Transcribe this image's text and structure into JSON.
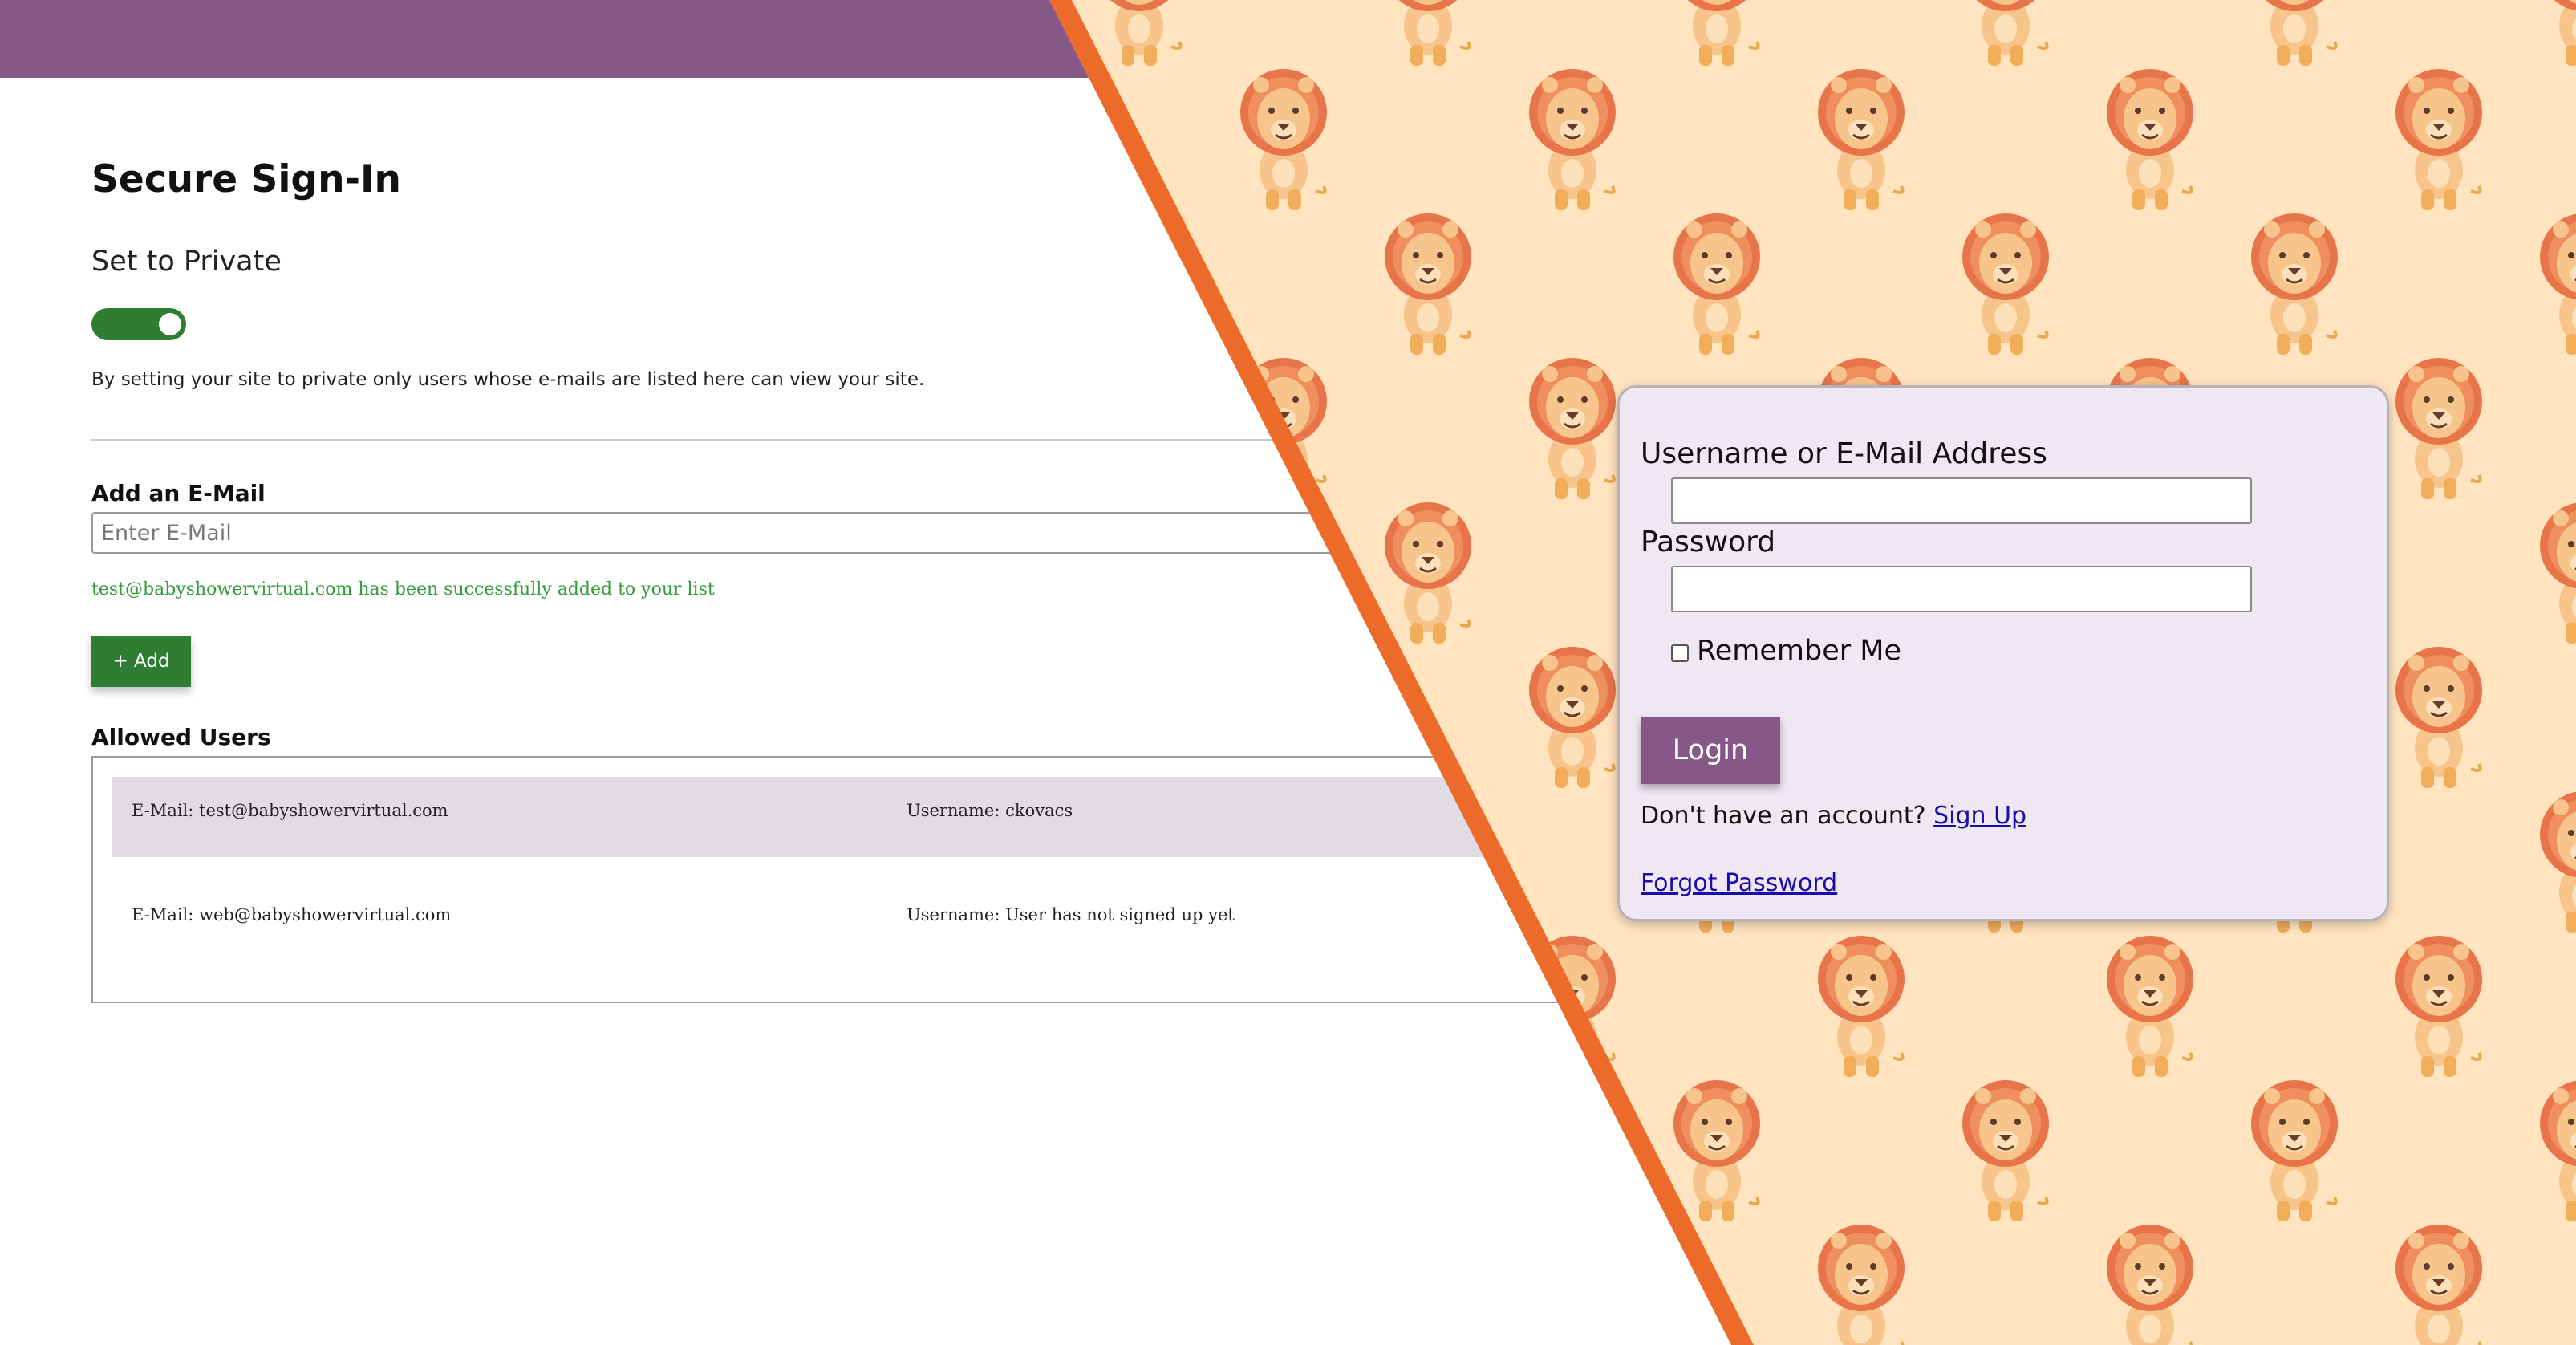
{
  "colors": {
    "brand_purple": "#855888",
    "accent_orange": "#ec6a2a",
    "toggle_green": "#2e7d32",
    "success_green": "#2e9d36",
    "background_peach": "#ffe4bf",
    "card_background": "#efe7f2"
  },
  "admin": {
    "title": "Secure Sign-In",
    "private_label": "Set to Private",
    "private_toggle_on": true,
    "private_description": "By setting your site to private only users whose e-mails are listed here can view your site.",
    "add_email_label": "Add an E-Mail",
    "email_placeholder": "Enter E-Mail",
    "email_value": "",
    "success_message": "test@babyshowervirtual.com has been successfully added to your list",
    "add_button_label": "+ Add",
    "allowed_users_label": "Allowed Users",
    "users": [
      {
        "email": "E-Mail: test@babyshowervirtual.com",
        "username": "Username: ckovacs"
      },
      {
        "email": "E-Mail: web@babyshowervirtual.com",
        "username": "Username: User has not signed up yet"
      }
    ]
  },
  "login": {
    "username_label": "Username or E-Mail Address",
    "username_value": "",
    "password_label": "Password",
    "password_value": "",
    "remember_label": "Remember Me",
    "remember_checked": false,
    "login_button": "Login",
    "no_account_text": "Don't have an account?",
    "signup_link": "Sign Up",
    "forgot_link": "Forgot Password"
  },
  "background": {
    "pattern_icon": "lion-icon"
  }
}
